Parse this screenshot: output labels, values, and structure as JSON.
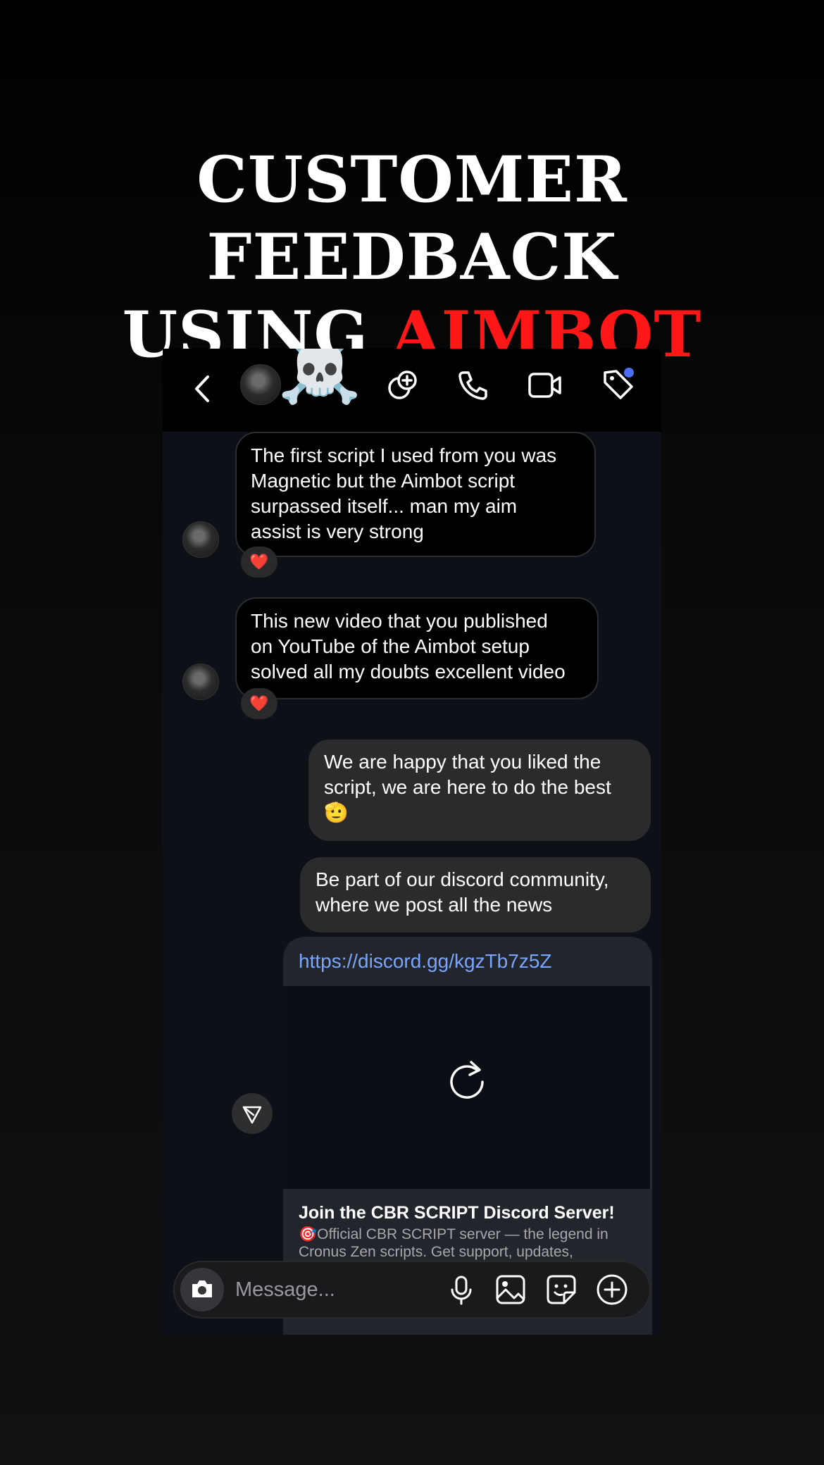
{
  "headline": {
    "line1": "CUSTOMER FEEDBACK",
    "line2_prefix": "USING ",
    "line2_accent": "AIMBOT"
  },
  "colors": {
    "accent": "#ff1717",
    "link": "#7aa5ff",
    "notification_dot": "#4b6cf5"
  },
  "header": {
    "icons": [
      "back-icon",
      "avatar",
      "skull-emoji",
      "new-group-icon",
      "phone-icon",
      "video-icon",
      "tag-icon"
    ],
    "skull": "☠️"
  },
  "messages": [
    {
      "from": "customer",
      "text": "The first script I used from you was\nMagnetic but the Aimbot script\nsurpassed itself... man my aim\nassist is very strong",
      "reaction": "❤️"
    },
    {
      "from": "customer",
      "text": "This new video that you published\non YouTube of the Aimbot setup\nsolved all my doubts excellent video",
      "reaction": "❤️"
    },
    {
      "from": "me",
      "text": "We are happy that you liked the\nscript, we are here to do the best\n🫡"
    },
    {
      "from": "me",
      "text": "Be part of our discord community,\nwhere we post all the news"
    }
  ],
  "link_preview": {
    "url": "https://discord.gg/kgzTb7z5Z",
    "title": "Join the CBR SCRIPT Discord Server!",
    "description": "🎯Official CBR SCRIPT server — the legend in\nCronus Zen scripts. Get support, updates,"
  },
  "composer": {
    "placeholder": "Message..."
  }
}
